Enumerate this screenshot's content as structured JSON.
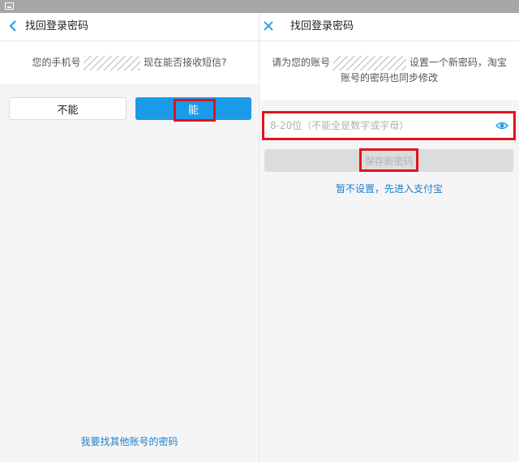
{
  "left": {
    "nav": {
      "title": "找回登录密码",
      "back_icon": "chevron-left-icon"
    },
    "prompt": {
      "before": "您的手机号",
      "after": "现在能否接收短信?"
    },
    "buttons": {
      "no": "不能",
      "yes": "能"
    },
    "footer_link": "我要找其他账号的密码"
  },
  "right": {
    "nav": {
      "title": "找回登录密码",
      "close_icon": "close-icon"
    },
    "prompt": {
      "line1_before": "请为您的账号",
      "line1_after": "设置一个新密码，淘宝",
      "line2": "账号的密码也同步修改"
    },
    "password": {
      "placeholder": "8-20位（不能全是数字或字母）",
      "value": ""
    },
    "save_label": "保存新密码",
    "skip_link": "暂不设置，先进入支付宝"
  },
  "colors": {
    "accent": "#1a9ae8",
    "link": "#1a7fc8",
    "highlight": "#e0141e",
    "disabled_button": "#dcdcdc"
  }
}
